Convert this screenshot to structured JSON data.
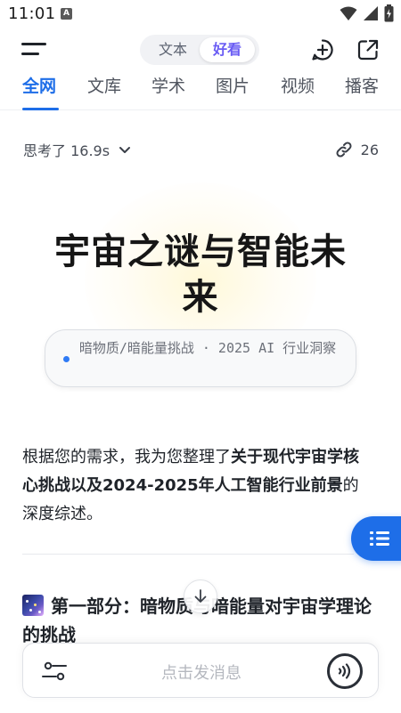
{
  "status_bar": {
    "time": "11:01",
    "notification_letter": "A",
    "icons": [
      "wifi-icon",
      "cellular-icon",
      "battery-icon"
    ]
  },
  "app_bar": {
    "segment": {
      "items": [
        "文本",
        "好看"
      ],
      "selected": "好看"
    },
    "icons": [
      "menu-icon",
      "new-chat-icon",
      "share-icon"
    ]
  },
  "tabs": [
    {
      "label": "全网",
      "active": true
    },
    {
      "label": "文库",
      "active": false
    },
    {
      "label": "学术",
      "active": false
    },
    {
      "label": "图片",
      "active": false
    },
    {
      "label": "视频",
      "active": false
    },
    {
      "label": "播客",
      "active": false
    }
  ],
  "thinking": {
    "label": "思考了 16.9s"
  },
  "references": {
    "count": "26"
  },
  "hero": {
    "title": "宇宙之谜与智能未来",
    "subtitle": "暗物质/暗能量挑战 · 2025 AI 行业洞察"
  },
  "intro": {
    "prefix": "根据您的需求，我为您整理了",
    "bold": "关于现代宇宙学核心挑战以及2024-2025年人工智能行业前景",
    "suffix": "的深度综述。"
  },
  "section": {
    "title": "第一部分：暗物质与暗能量对宇宙学理论的挑战"
  },
  "input": {
    "placeholder": "点击发消息"
  },
  "colors": {
    "accent": "#1e6ee8",
    "segment_selected": "#6a5cf4",
    "text_primary": "#1f2329",
    "text_secondary": "#474c56"
  }
}
